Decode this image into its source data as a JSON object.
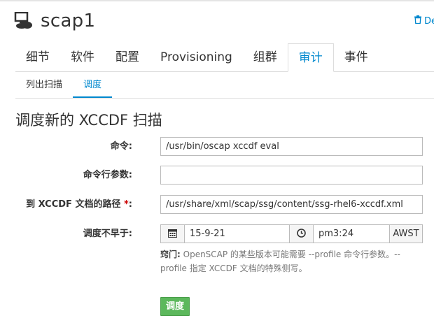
{
  "header": {
    "system_name": "scap1",
    "delete_label": "De"
  },
  "tabs": [
    {
      "label": "细节"
    },
    {
      "label": "软件"
    },
    {
      "label": "配置"
    },
    {
      "label": "Provisioning"
    },
    {
      "label": "组群"
    },
    {
      "label": "审计",
      "active": true
    },
    {
      "label": "事件"
    }
  ],
  "subtabs": [
    {
      "label": "列出扫描"
    },
    {
      "label": "调度",
      "active": true
    }
  ],
  "form": {
    "title": "调度新的 XCCDF 扫描",
    "command": {
      "label": "命令:",
      "value": "/usr/bin/oscap xccdf eval"
    },
    "args": {
      "label": "命令行参数:",
      "value": ""
    },
    "path": {
      "label": "到 XCCDF 文档的路径 ",
      "required_mark": "*",
      "colon": ":",
      "value": "/usr/share/xml/scap/ssg/content/ssg-rhel6-xccdf.xml"
    },
    "schedule": {
      "label": "调度不早于:",
      "date": "15-9-21",
      "time": "pm3:24",
      "timezone": "AWST"
    },
    "help": {
      "prefix": "窍门:",
      "text": " OpenSCAP 的某些版本可能需要 --profile 命令行参数。-- profile 指定 XCCDF 文档的特殊侧写。"
    },
    "submit_label": "调度"
  },
  "colors": {
    "accent": "#0088ce",
    "submit": "#5cb85c",
    "required": "#cc0000"
  }
}
